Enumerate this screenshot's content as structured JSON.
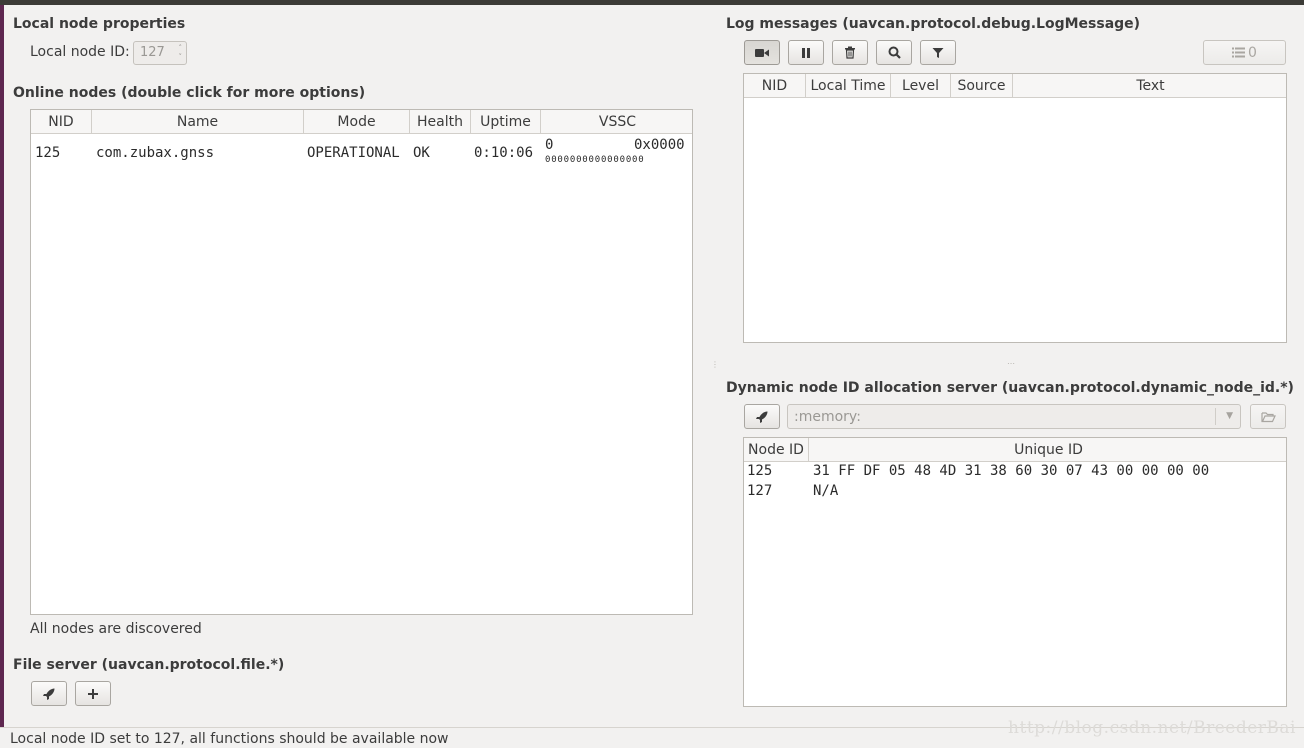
{
  "local_node": {
    "title": "Local node properties",
    "id_label": "Local node ID:",
    "id_value": "127"
  },
  "online_nodes": {
    "title": "Online nodes (double click for more options)",
    "columns": [
      "NID",
      "Name",
      "Mode",
      "Health",
      "Uptime",
      "VSSC"
    ],
    "rows": [
      {
        "nid": "125",
        "name": "com.zubax.gnss",
        "mode": "OPERATIONAL",
        "health": "OK",
        "uptime": "0:10:06",
        "vssc_dec": "0",
        "vssc_hex": "0x0000",
        "vssc_bits": "0000000000000000"
      }
    ],
    "status": "All nodes are discovered"
  },
  "file_server": {
    "title": "File server (uavcan.protocol.file.*)"
  },
  "log_messages": {
    "title": "Log messages (uavcan.protocol.debug.LogMessage)",
    "columns": [
      "NID",
      "Local Time",
      "Level",
      "Source",
      "Text"
    ],
    "count_value": "0"
  },
  "dynamic_alloc": {
    "title": "Dynamic node ID allocation server (uavcan.protocol.dynamic_node_id.*)",
    "db_path": ":memory:",
    "columns": [
      "Node ID",
      "Unique ID"
    ],
    "rows": [
      {
        "node_id": "125",
        "unique_id": "31 FF DF 05 48 4D 31 38 60 30 07 43 00 00 00 00"
      },
      {
        "node_id": "127",
        "unique_id": "N/A"
      }
    ]
  },
  "statusbar": {
    "message": "Local node ID set to 127, all functions should be available now"
  },
  "watermark": "http://blog.csdn.net/BreederBai",
  "colors": {
    "window_bg": "#f2f1f0",
    "table_bg": "#ffffff",
    "left_edge": "#5e2750"
  }
}
